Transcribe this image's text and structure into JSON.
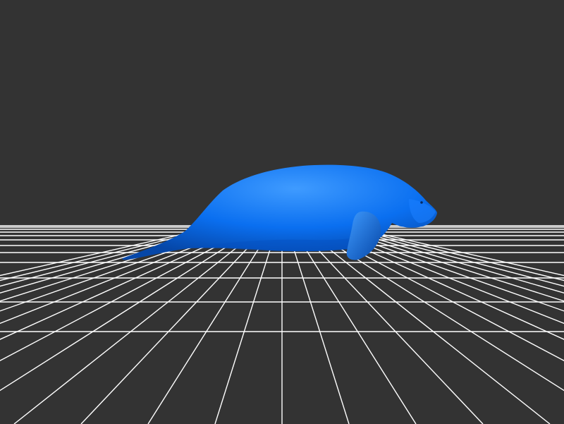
{
  "scene": {
    "background_color": "#333333",
    "grid_color": "#ffffff",
    "model_color": "#0a6ff0",
    "model_shadow_color": "#0647a8",
    "model_highlight_color": "#3f9bff",
    "model": "manatee"
  }
}
